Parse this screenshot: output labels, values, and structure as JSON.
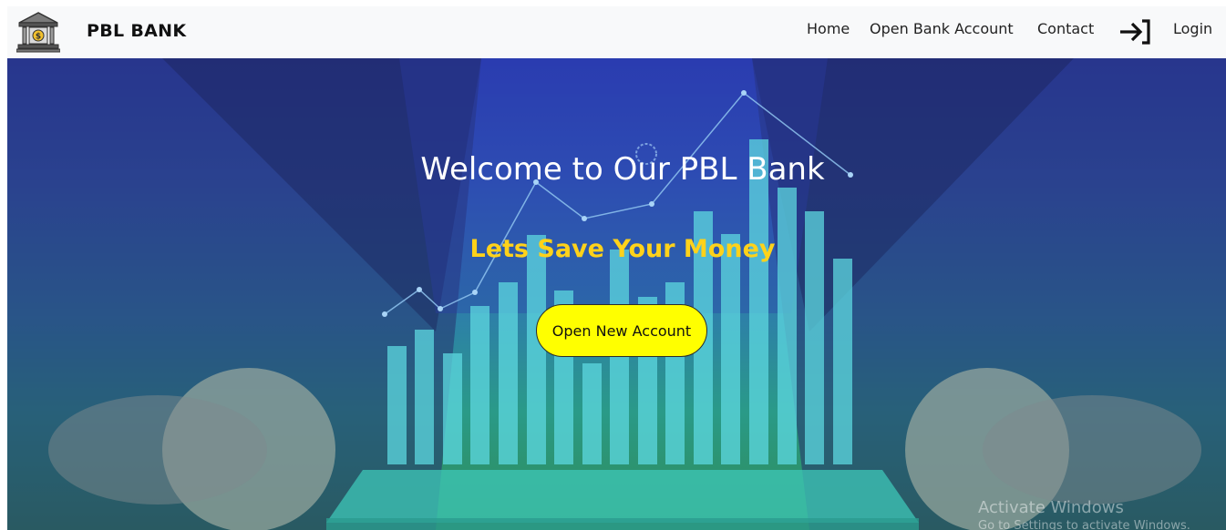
{
  "navbar": {
    "brand": "PBL BANK",
    "logo_icon": "bank-building-icon",
    "links": [
      "Home",
      "Open Bank Account",
      "Contact"
    ],
    "login_icon": "login-arrow-icon",
    "login_label": "Login"
  },
  "hero": {
    "title": "Welcome to Our PBL Bank",
    "subtitle": "Lets Save Your Money",
    "cta_label": "Open New Account",
    "background": "business person holding tablet with glowing bar chart"
  },
  "watermark": {
    "title": "Activate Windows",
    "subtitle": "Go to Settings to activate Windows."
  },
  "colors": {
    "navbar_bg": "#f8f9fa",
    "subtitle": "#ffd21a",
    "cta_bg": "#ffff00",
    "hero_top": "#2a3cb4",
    "hero_bottom": "#2e8c55"
  }
}
